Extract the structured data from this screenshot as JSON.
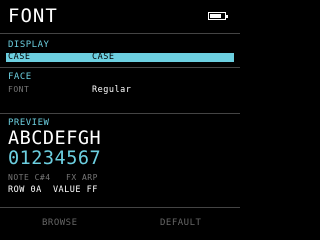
{
  "header": {
    "title": "FONT",
    "battery_icon": "battery-icon"
  },
  "display": {
    "label": "DISPLAY",
    "selected_row": {
      "left": "CASE",
      "right": "CASE"
    }
  },
  "face": {
    "label": "FACE",
    "field_label": "FONT",
    "field_value": "Regular"
  },
  "preview": {
    "label": "PREVIEW",
    "letters": "ABCDEFGH",
    "digits": "01234567",
    "line1_dim": "NOTE C#4",
    "line1_right_dim": "FX ARP",
    "line2": "ROW 0A  VALUE FF"
  },
  "footer": {
    "left": "BROWSE",
    "right": "DEFAULT"
  },
  "colors": {
    "accent": "#6ccfe0",
    "background": "#000000",
    "dim": "#777777"
  }
}
